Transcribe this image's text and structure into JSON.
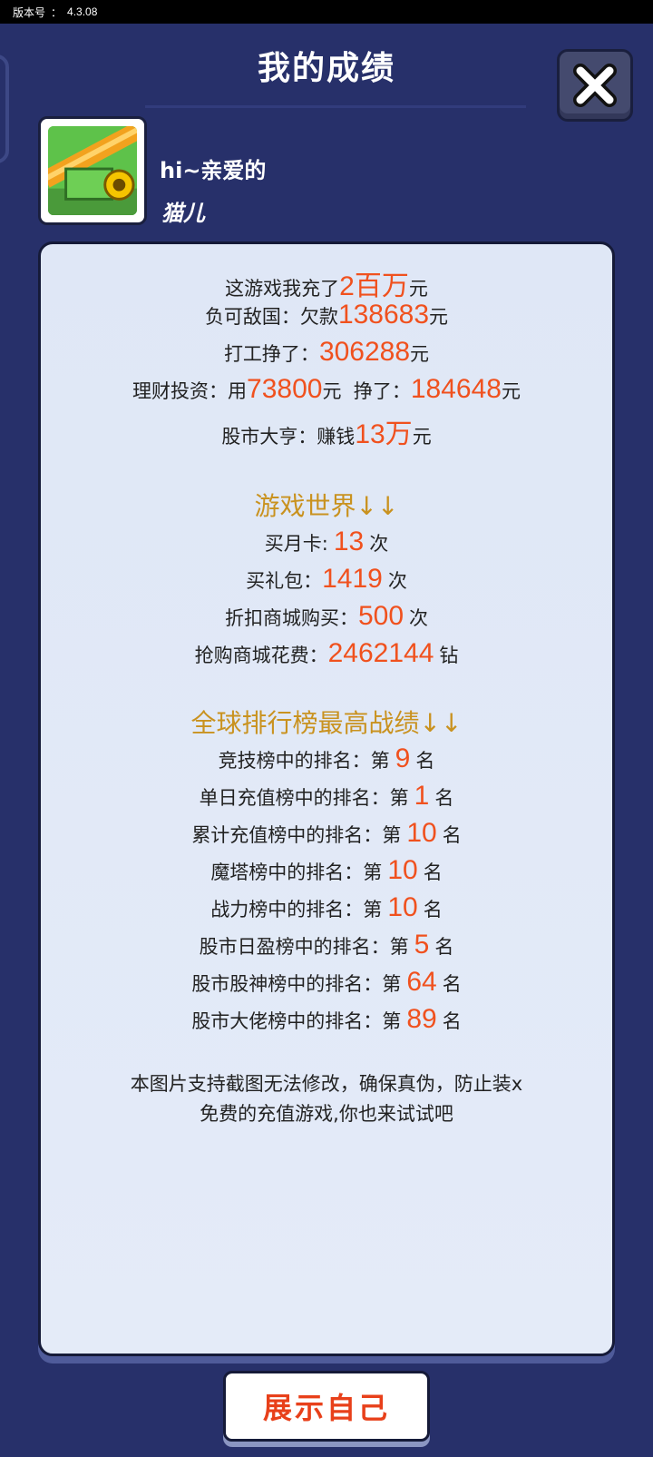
{
  "version": {
    "label": "版本号",
    "sep": "：",
    "value": "4.3.08"
  },
  "header": {
    "title": "我的成绩"
  },
  "user": {
    "greeting": "hi~亲爱的",
    "nickname": "猫儿"
  },
  "stats": {
    "recharge": {
      "prefix": "这游戏我充了",
      "value": "2百万",
      "suffix": "元"
    },
    "debt": {
      "prefix": "负可敌国：欠款",
      "value": "138683",
      "suffix": "元"
    },
    "work": {
      "prefix": "打工挣了：",
      "value": "306288",
      "suffix": "元"
    },
    "invest": {
      "prefix": "理财投资：用",
      "used": "73800",
      "mid": "元  挣了：",
      "earned": "184648",
      "suffix": "元"
    },
    "stock": {
      "prefix": "股市大亨：赚钱",
      "value": "13万",
      "suffix": "元"
    }
  },
  "game_world": {
    "title": "游戏世界↓↓",
    "rows": [
      {
        "prefix": "买月卡:",
        "value": "13",
        "suffix": "次"
      },
      {
        "prefix": "买礼包：",
        "value": "1419",
        "suffix": "次"
      },
      {
        "prefix": "折扣商城购买：",
        "value": "500",
        "suffix": "次"
      },
      {
        "prefix": "抢购商城花费：",
        "value": "2462144",
        "suffix": "钻"
      }
    ]
  },
  "rankings": {
    "title": "全球排行榜最高战绩↓↓",
    "rows": [
      {
        "prefix": "竞技榜中的排名：第",
        "value": "9",
        "suffix": "名"
      },
      {
        "prefix": "单日充值榜中的排名：第",
        "value": "1",
        "suffix": "名"
      },
      {
        "prefix": "累计充值榜中的排名：第",
        "value": "10",
        "suffix": "名"
      },
      {
        "prefix": "魔塔榜中的排名：第",
        "value": "10",
        "suffix": "名"
      },
      {
        "prefix": "战力榜中的排名：第",
        "value": "10",
        "suffix": "名"
      },
      {
        "prefix": "股市日盈榜中的排名：第",
        "value": "5",
        "suffix": "名"
      },
      {
        "prefix": "股市股神榜中的排名：第",
        "value": "64",
        "suffix": "名"
      },
      {
        "prefix": "股市大佬榜中的排名：第",
        "value": "89",
        "suffix": "名"
      }
    ]
  },
  "note": {
    "line1": "本图片支持截图无法修改，确保真伪，防止装x",
    "line2": "免费的充值游戏,你也来试试吧"
  },
  "actions": {
    "show_label": "展示自己"
  },
  "colors": {
    "background": "#27306a",
    "highlight": "#f0511e",
    "section": "#c9921f",
    "panel": "#dfe7f6"
  },
  "icons": {
    "close": "close-x-icon",
    "avatar": "cannon-avatar-icon"
  }
}
